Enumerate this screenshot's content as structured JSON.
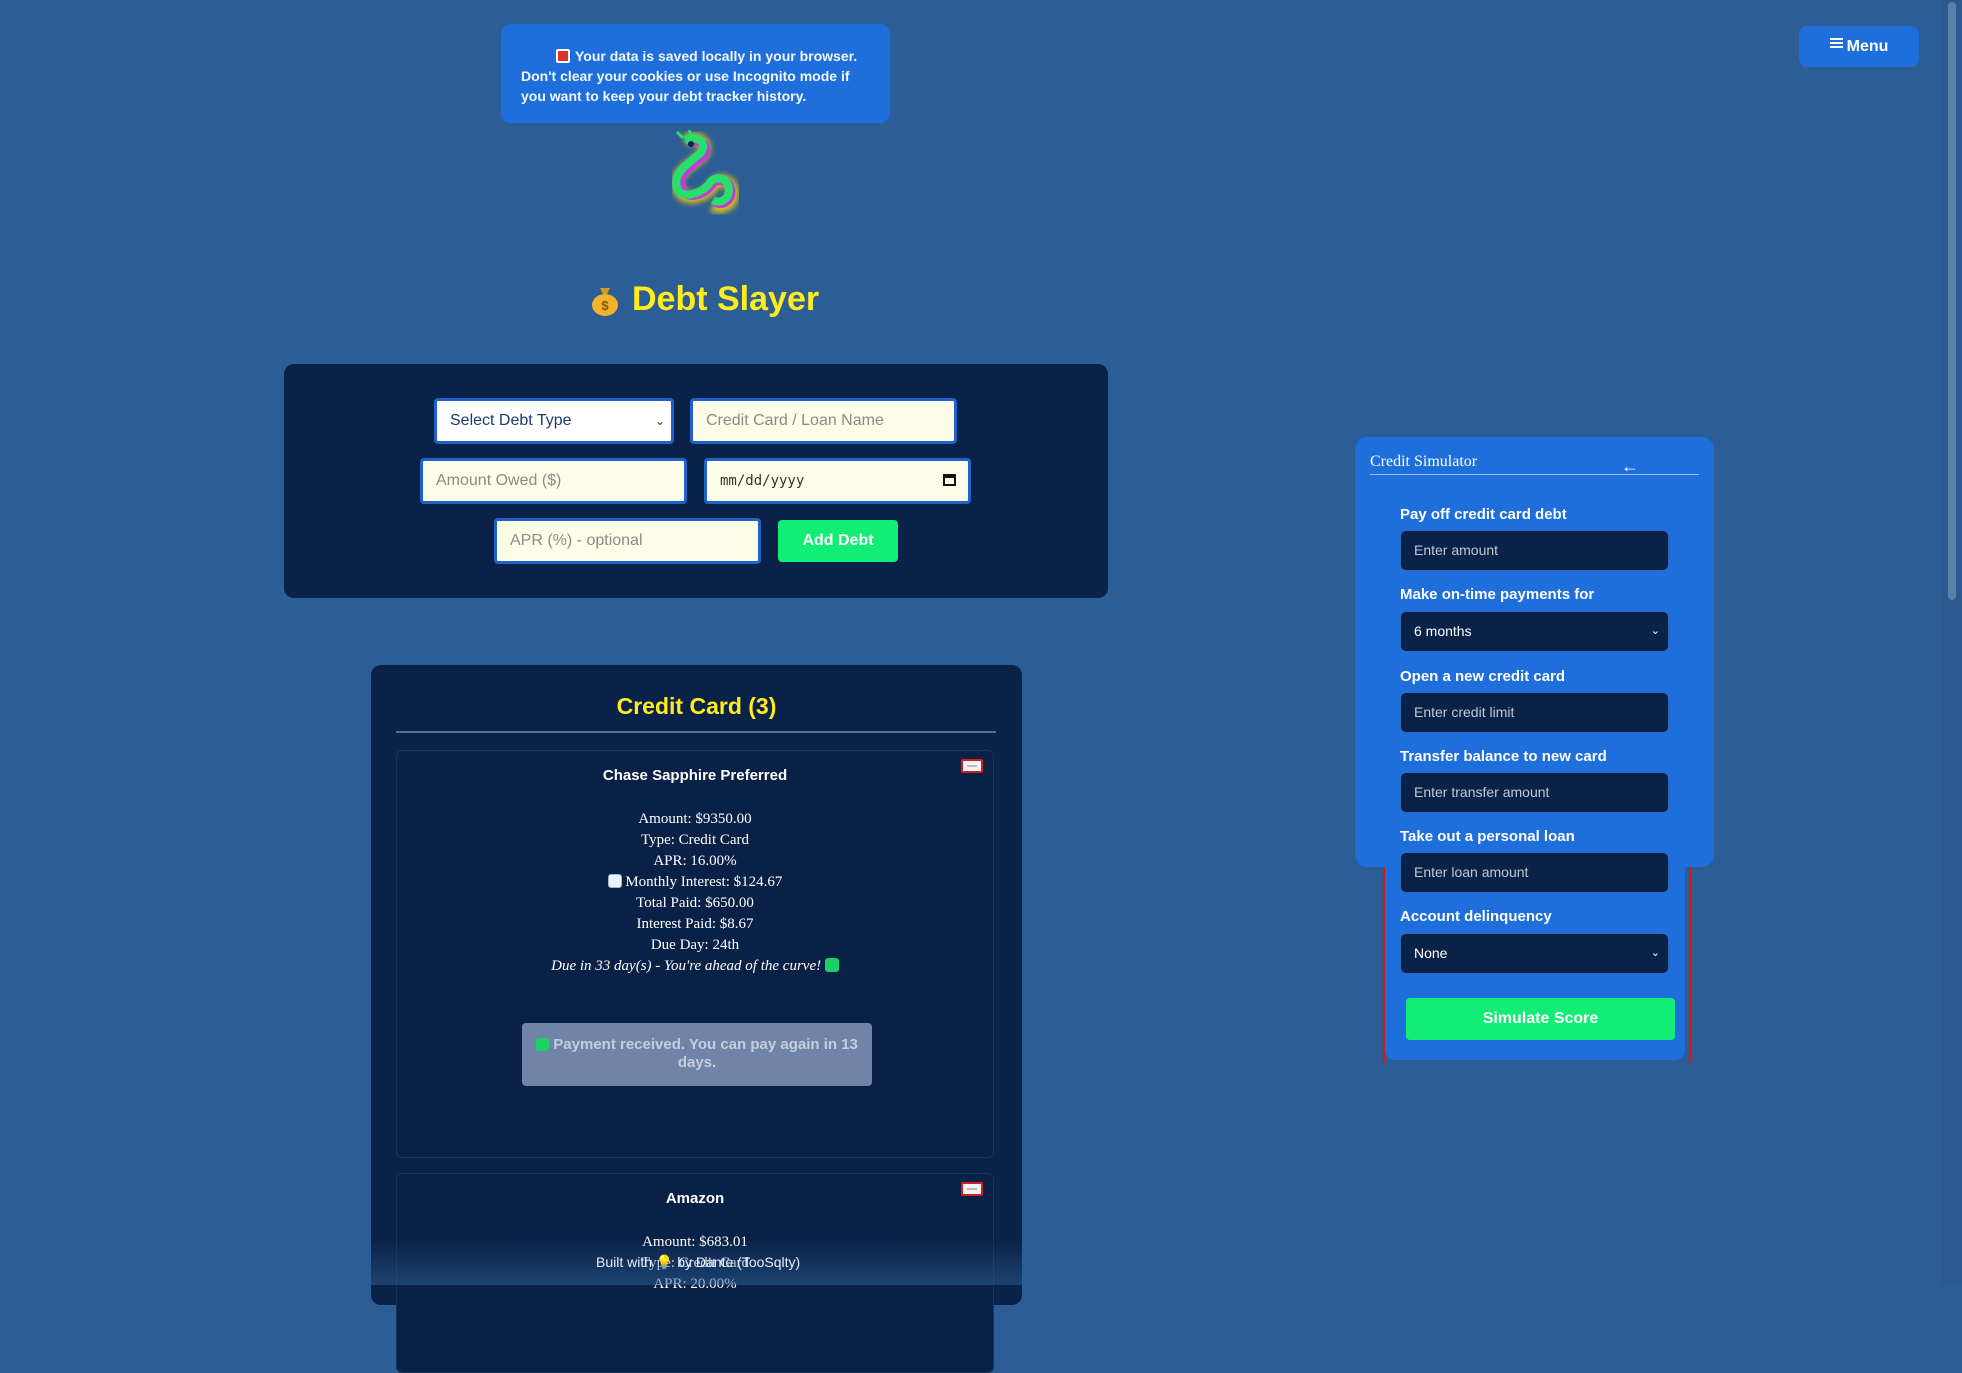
{
  "notice": {
    "text": "Your data is saved locally in your browser. Don't clear your cookies or use Incognito mode if you want to keep your debt tracker history."
  },
  "menu": {
    "label": "Menu"
  },
  "app": {
    "title": "Debt Slayer"
  },
  "form": {
    "debt_type": "Select Debt Type",
    "name_placeholder": "Credit Card / Loan Name",
    "amount_placeholder": "Amount Owed ($)",
    "date_placeholder": "mm/dd/yyyy",
    "apr_placeholder": "APR (%) - optional",
    "add_label": "Add Debt"
  },
  "list": {
    "group_title": "Credit Card (3)",
    "cards": [
      {
        "name": "Chase Sapphire Preferred",
        "amount": "Amount: $9350.00",
        "type": "Type: Credit Card",
        "apr": "APR: 16.00%",
        "monthly_interest": "Monthly Interest: $124.67",
        "total_paid": "Total Paid: $650.00",
        "interest_paid": "Interest Paid: $8.67",
        "due_day": "Due Day: 24th",
        "due_status": "Due in 33 day(s) - You're ahead of the curve!",
        "payment_status": "Payment received. You can pay again in 13 days."
      },
      {
        "name": "Amazon",
        "amount": "Amount: $683.01",
        "type": "Type: Credit Card",
        "apr": "APR: 20.00%"
      }
    ]
  },
  "footer": {
    "text": "Built with 💡 by Dante (TooSqlty)"
  },
  "simulator": {
    "title": "Credit Simulator",
    "back_glyph": "←",
    "fields": [
      {
        "label": "Pay off credit card debt",
        "placeholder": "Enter amount"
      },
      {
        "label": "Make on-time payments for",
        "value": "6 months"
      },
      {
        "label": "Open a new credit card",
        "placeholder": "Enter credit limit"
      },
      {
        "label": "Transfer balance to new card",
        "placeholder": "Enter transfer amount"
      },
      {
        "label": "Take out a personal loan",
        "placeholder": "Enter loan amount"
      },
      {
        "label": "Account delinquency",
        "value": "None"
      }
    ],
    "submit_label": "Simulate Score"
  },
  "colors": {
    "background": "#2c5d94",
    "panel": "#0b2248",
    "accent": "#1e6fdc",
    "green": "#12ee75",
    "title_yellow": "#ffec1f"
  }
}
